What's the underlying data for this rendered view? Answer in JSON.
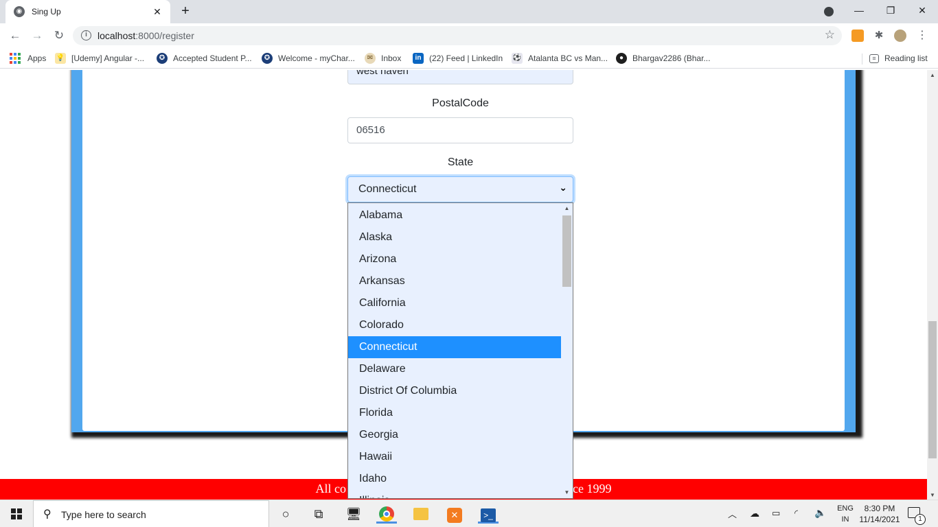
{
  "browser": {
    "tab_title": "Sing Up",
    "tab_close": "✕",
    "new_tab": "+",
    "url_host": "localhost",
    "url_path": ":8000/register",
    "window_controls": {
      "minimize": "—",
      "restore": "❐",
      "close": "✕"
    }
  },
  "bookmarks": [
    {
      "label": "Apps",
      "icon": "apps-grid-icon"
    },
    {
      "label": "[Udemy] Angular -...",
      "icon": "bulb-icon"
    },
    {
      "label": "Accepted Student P...",
      "icon": "seal-icon"
    },
    {
      "label": "Welcome - myChar...",
      "icon": "seal-icon"
    },
    {
      "label": "Inbox",
      "icon": "mail-icon"
    },
    {
      "label": "(22) Feed | LinkedIn",
      "icon": "linkedin-icon"
    },
    {
      "label": "Atalanta BC vs Man...",
      "icon": "football-icon"
    },
    {
      "label": "Bhargav2286 (Bhar...",
      "icon": "github-icon"
    }
  ],
  "reading_list": "Reading list",
  "form": {
    "city_value": "west haven",
    "postal_label": "PostalCode",
    "postal_value": "06516",
    "state_label": "State",
    "state_selected": "Connecticut"
  },
  "state_options": [
    "Alabama",
    "Alaska",
    "Arizona",
    "Arkansas",
    "California",
    "Colorado",
    "Connecticut",
    "Delaware",
    "District Of Columbia",
    "Florida",
    "Georgia",
    "Hawaii",
    "Idaho",
    "Illinois"
  ],
  "footer": {
    "text_left": "All co",
    "text_right": "ce 1999",
    "color": "#ff0000"
  },
  "taskbar": {
    "search_placeholder": "Type here to search",
    "lang_top": "ENG",
    "lang_bottom": "IN",
    "time": "8:30 PM",
    "date": "11/14/2021",
    "notification_count": "1"
  },
  "colors": {
    "card_frame": "#52a7ee",
    "selected_option": "#1e90ff",
    "autofill_bg": "#e8f0fe"
  }
}
